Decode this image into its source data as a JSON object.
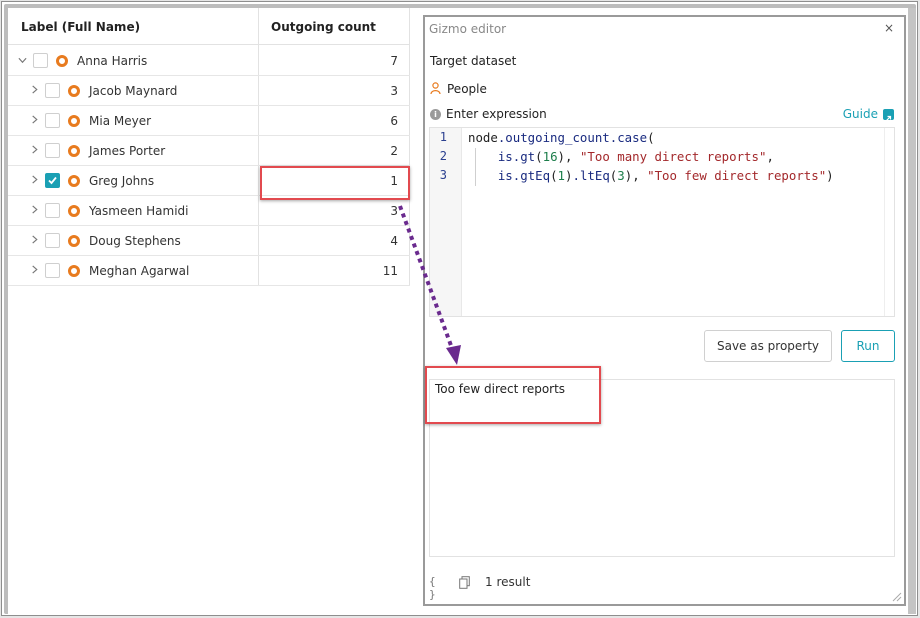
{
  "table": {
    "headers": {
      "label": "Label (Full Name)",
      "count": "Outgoing count"
    },
    "rows": [
      {
        "name": "Anna Harris",
        "count": "7",
        "expanded": true,
        "checked": false
      },
      {
        "name": "Jacob Maynard",
        "count": "3",
        "expanded": false,
        "checked": false
      },
      {
        "name": "Mia Meyer",
        "count": "6",
        "expanded": false,
        "checked": false
      },
      {
        "name": "James Porter",
        "count": "2",
        "expanded": false,
        "checked": false
      },
      {
        "name": "Greg Johns",
        "count": "1",
        "expanded": false,
        "checked": true
      },
      {
        "name": "Yasmeen Hamidi",
        "count": "3",
        "expanded": false,
        "checked": false
      },
      {
        "name": "Doug Stephens",
        "count": "4",
        "expanded": false,
        "checked": false
      },
      {
        "name": "Meghan Agarwal",
        "count": "11",
        "expanded": false,
        "checked": false
      }
    ]
  },
  "gizmo": {
    "title": "Gizmo editor",
    "close": "×",
    "target_label": "Target dataset",
    "dataset": "People",
    "expression_label": "Enter expression",
    "guide": "Guide",
    "line_numbers": [
      "1",
      "2",
      "3"
    ],
    "code": {
      "line1": {
        "obj": "node",
        "mem1": ".outgoing_count",
        "mem2": ".case",
        "rest": "("
      },
      "line2": {
        "obj": "is",
        "mem": ".gt",
        "open": "(",
        "num": "16",
        "close": "), ",
        "str": "\"Too many direct reports\"",
        "end": ","
      },
      "line3": {
        "obj": "is",
        "mem1": ".gtEq",
        "open1": "(",
        "num1": "1",
        "close1": ")",
        "mem2": ".ltEq",
        "open2": "(",
        "num2": "3",
        "close2": "), ",
        "str": "\"Too few direct reports\"",
        "end": ")"
      }
    },
    "save_button": "Save as property",
    "run_button": "Run",
    "result_text": "Too few direct reports",
    "braces": "{ }",
    "result_count": "1 result"
  },
  "colors": {
    "accent": "#1aa0b4",
    "node": "#e87b1f",
    "highlight": "#e24a4f",
    "arrow": "#6a2a8e"
  },
  "icons": {
    "dataset": "person-icon",
    "info": "info-icon",
    "guide": "external-link-icon",
    "copy": "copy-icon"
  }
}
